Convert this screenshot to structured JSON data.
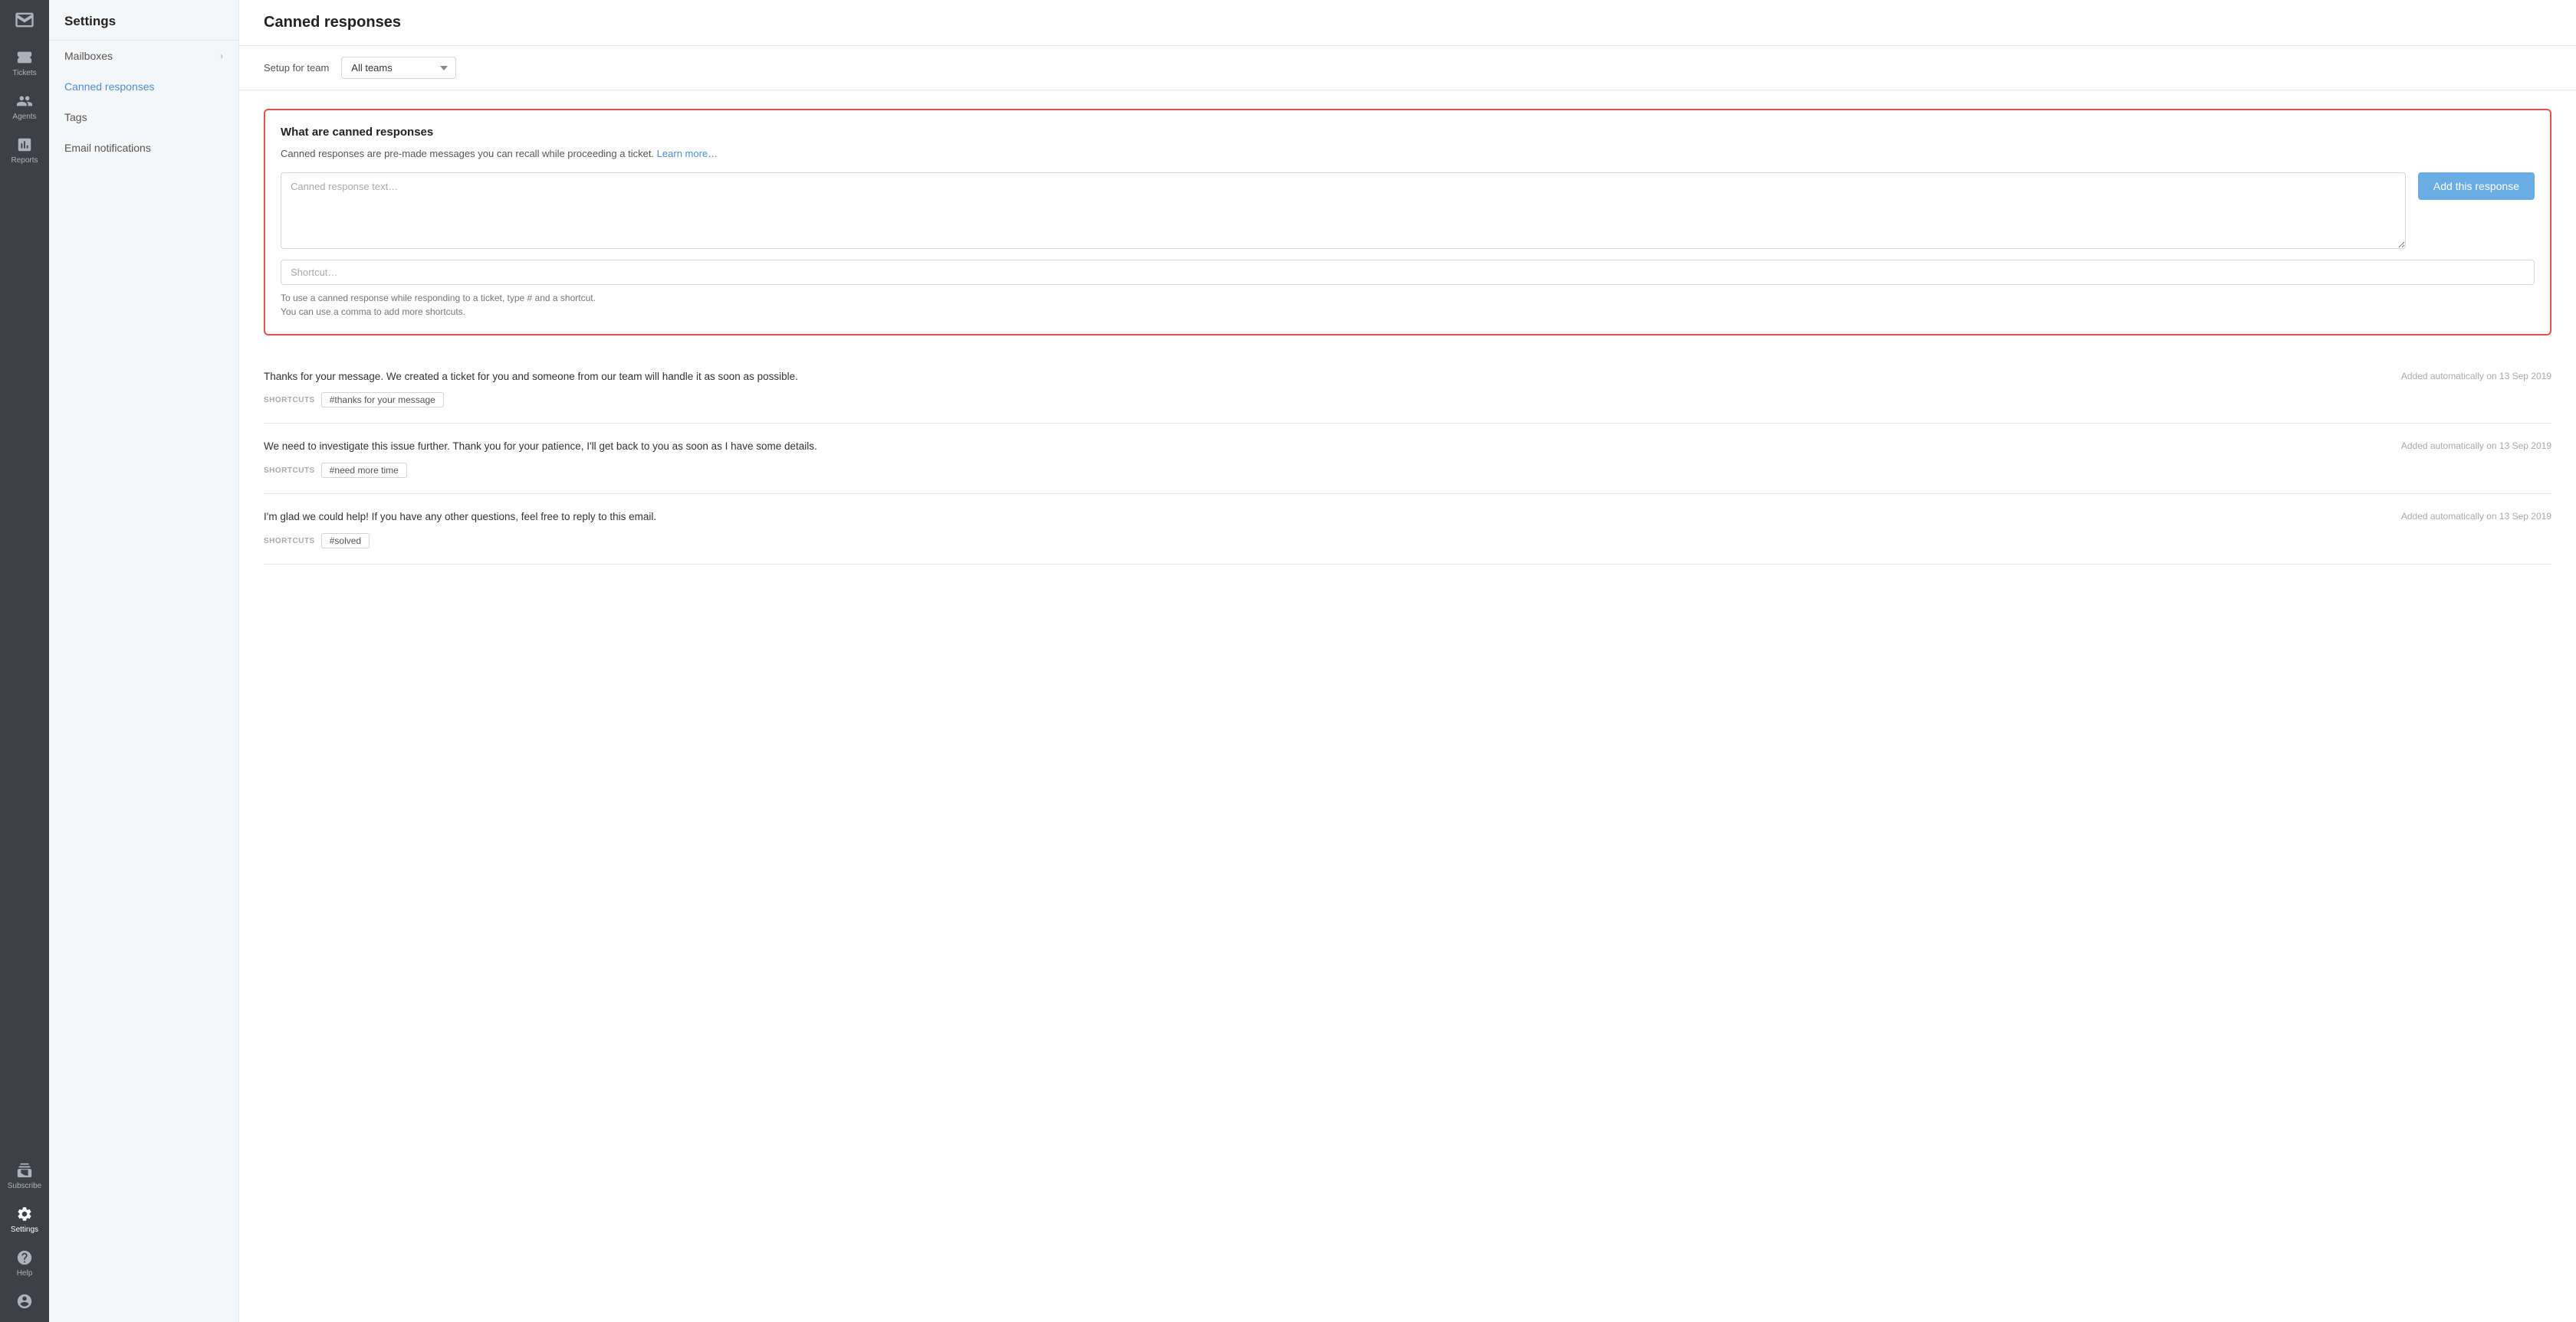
{
  "app": {
    "title": "Canned responses"
  },
  "icon_sidebar": {
    "items": [
      {
        "id": "inbox",
        "label": "",
        "icon": "inbox"
      },
      {
        "id": "tickets",
        "label": "Tickets",
        "icon": "ticket"
      },
      {
        "id": "agents",
        "label": "Agents",
        "icon": "agents"
      },
      {
        "id": "reports",
        "label": "Reports",
        "icon": "reports"
      },
      {
        "id": "subscribe",
        "label": "Subscribe",
        "icon": "subscribe"
      },
      {
        "id": "settings",
        "label": "Settings",
        "icon": "settings",
        "active": true
      },
      {
        "id": "help",
        "label": "Help",
        "icon": "help"
      },
      {
        "id": "profile",
        "label": "",
        "icon": "profile"
      }
    ]
  },
  "settings_panel": {
    "header": "Settings",
    "nav_items": [
      {
        "id": "mailboxes",
        "label": "Mailboxes",
        "has_arrow": true
      },
      {
        "id": "canned_responses",
        "label": "Canned responses",
        "active": true
      },
      {
        "id": "tags",
        "label": "Tags"
      },
      {
        "id": "email_notifications",
        "label": "Email notifications"
      }
    ]
  },
  "team_selector": {
    "label": "Setup for team",
    "options": [
      "All teams"
    ],
    "selected": "All teams"
  },
  "add_form": {
    "title": "What are canned responses",
    "description": "Canned responses are pre-made messages you can recall while proceeding a ticket.",
    "learn_more_text": "Learn more…",
    "textarea_placeholder": "Canned response text…",
    "shortcut_placeholder": "Shortcut…",
    "hint_line1": "To use a canned response while responding to a ticket, type # and a shortcut.",
    "hint_line2": "You can use a comma to add more shortcuts.",
    "add_button_label": "Add this response"
  },
  "canned_responses": [
    {
      "id": 1,
      "text": "Thanks for your message. We created a ticket for you and someone from our team will handle it as soon as possible.",
      "meta": "Added automatically on 13 Sep 2019",
      "shortcuts_label": "SHORTCUTS",
      "shortcuts": [
        "#thanks for your message"
      ]
    },
    {
      "id": 2,
      "text": "We need to investigate this issue further. Thank you for your patience, I'll get back to you as soon as I have some details.",
      "meta": "Added automatically on 13 Sep 2019",
      "shortcuts_label": "SHORTCUTS",
      "shortcuts": [
        "#need more time"
      ]
    },
    {
      "id": 3,
      "text": "I'm glad we could help! If you have any other questions, feel free to reply to this email.",
      "meta": "Added automatically on 13 Sep 2019",
      "shortcuts_label": "SHORTCUTS",
      "shortcuts": [
        "#solved"
      ]
    }
  ]
}
